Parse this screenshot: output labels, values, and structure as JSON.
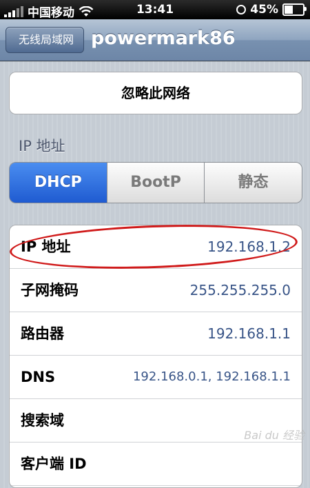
{
  "status_bar": {
    "carrier": "中国移动",
    "time": "13:41",
    "battery": "45%",
    "battery_level": 0.45
  },
  "nav": {
    "back_label": "无线局域网",
    "title": "powermark86"
  },
  "forget_button": "忽略此网络",
  "ip_section": {
    "label": "IP 地址",
    "segments": [
      "DHCP",
      "BootP",
      "静态"
    ],
    "selected": "DHCP"
  },
  "rows": [
    {
      "label": "IP 地址",
      "value": "192.168.1.2"
    },
    {
      "label": "子网掩码",
      "value": "255.255.255.0"
    },
    {
      "label": "路由器",
      "value": "192.168.1.1"
    },
    {
      "label": "DNS",
      "value": "192.168.0.1, 192.168.1.1"
    },
    {
      "label": "搜索域",
      "value": ""
    },
    {
      "label": "客户端 ID",
      "value": ""
    }
  ],
  "watermark": "Bai du 经验",
  "colors": {
    "segment_active": "#1f5bd1",
    "value_text": "#385487",
    "annotation": "#d01a1a"
  }
}
